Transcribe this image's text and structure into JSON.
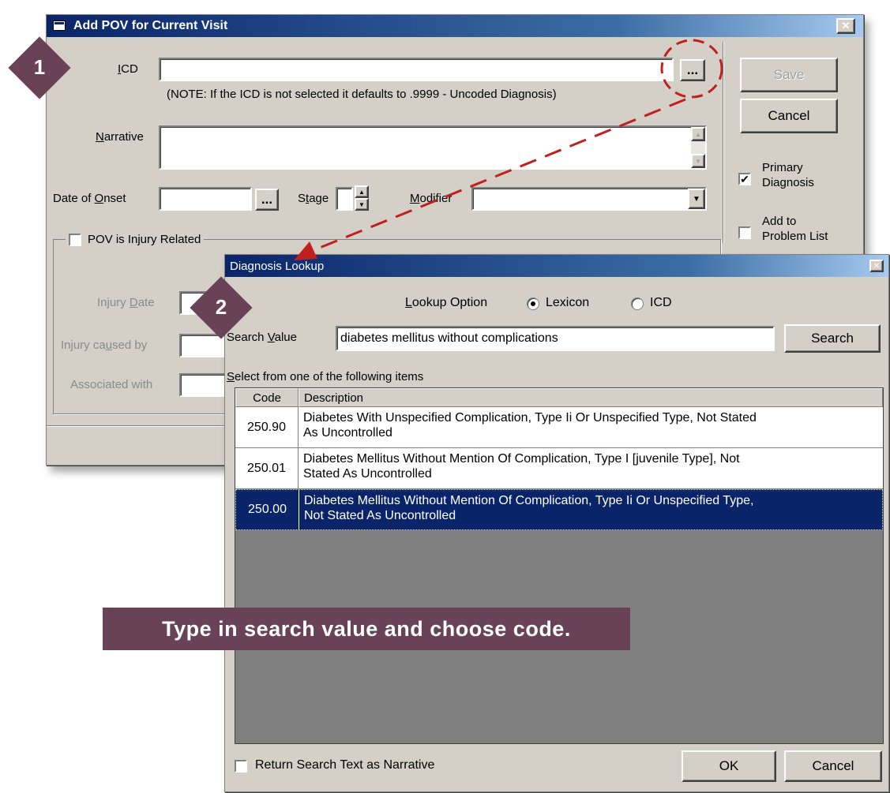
{
  "pov_dialog": {
    "title": "Add POV for Current Visit",
    "close_glyph": "✕",
    "icd": {
      "label_u": "I",
      "label_rest": "CD",
      "value": "",
      "ellipsis": "...",
      "note": "(NOTE: If the  ICD is not selected it defaults to .9999 - Uncoded Diagnosis)"
    },
    "narrative": {
      "label_u": "N",
      "label_rest": "arrative",
      "value": ""
    },
    "onset": {
      "label_pre": "Date of ",
      "label_u": "O",
      "label_rest": "nset",
      "value": "",
      "ellipsis": "..."
    },
    "stage": {
      "label_pre": "S",
      "label_u": "t",
      "label_rest": "age",
      "value": ""
    },
    "modifier": {
      "label_u": "M",
      "label_rest": "odifier",
      "value": ""
    },
    "buttons": {
      "save": "Save",
      "cancel": "Cancel"
    },
    "primary_diagnosis": {
      "line1": "Primary",
      "line2": "Diagnosis",
      "checked_glyph": "✔"
    },
    "add_problem": {
      "line1": "Add to",
      "line2": "Problem List"
    },
    "injury": {
      "group_label": "POV is Injury Related",
      "date_pre": "Injury ",
      "date_u": "D",
      "date_rest": "ate",
      "caused_pre": "Injury ca",
      "caused_u": "u",
      "caused_rest": "sed by",
      "assoc": "Associated with"
    }
  },
  "lookup_dialog": {
    "title": "Diagnosis Lookup",
    "close_glyph": "✕",
    "lookup_option": {
      "label_u": "L",
      "label_rest": "ookup Option",
      "options": [
        "Lexicon",
        "ICD"
      ],
      "selected": "Lexicon"
    },
    "search": {
      "label_pre": "Search ",
      "label_u": "V",
      "label_rest": "alue",
      "value": "diabetes mellitus without complications",
      "button": "Search"
    },
    "list_label": {
      "u": "S",
      "rest": "elect from one of the following items"
    },
    "columns": {
      "code": "Code",
      "description": "Description"
    },
    "rows": [
      {
        "code": "250.90",
        "line1": "Diabetes With Unspecified Complication, Type Ii Or Unspecified Type, Not Stated",
        "line2": "As Uncontrolled"
      },
      {
        "code": "250.01",
        "line1": "Diabetes Mellitus Without Mention Of Complication, Type I [juvenile Type], Not",
        "line2": "Stated As Uncontrolled"
      },
      {
        "code": "250.00",
        "line1": "Diabetes Mellitus Without Mention Of Complication, Type Ii Or Unspecified Type,",
        "line2": "Not Stated As Uncontrolled"
      }
    ],
    "selected_code": "250.00",
    "return_text": "Return Search Text as Narrative",
    "ok": "OK",
    "cancel": "Cancel"
  },
  "callouts": {
    "step1": "1",
    "step2": "2",
    "instruction": "Type in search value and choose code."
  },
  "colors": {
    "title_start": "#0a246a",
    "title_end": "#a6caf0",
    "selection": "#0a246a",
    "annotation": "#6a4258",
    "dash": "#c0201e"
  }
}
